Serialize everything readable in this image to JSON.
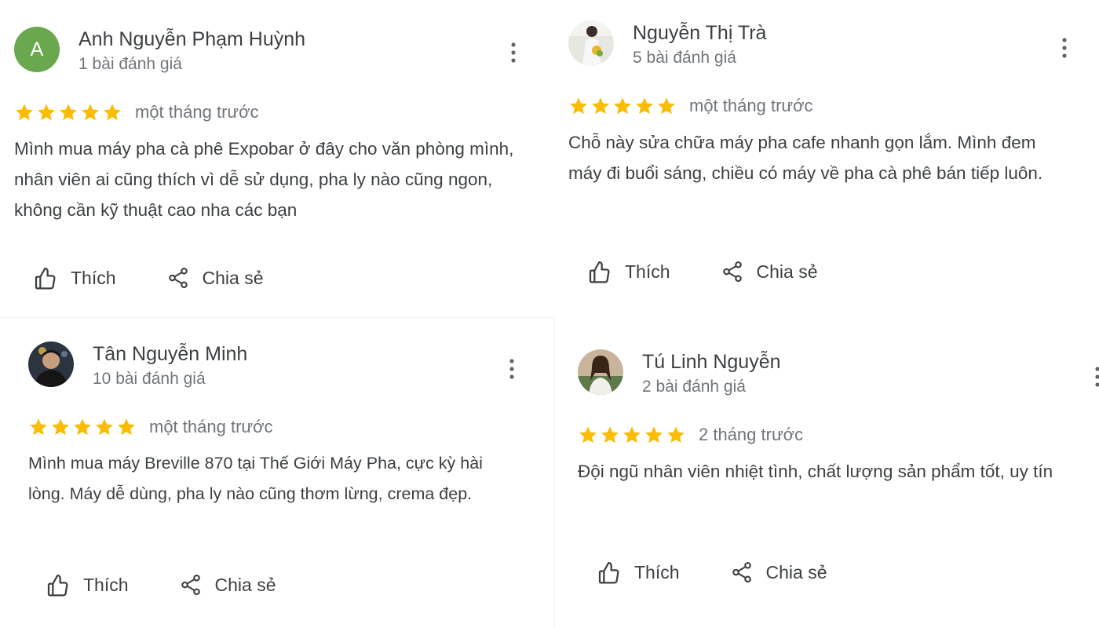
{
  "actions": {
    "like_label": "Thích",
    "share_label": "Chia sẻ"
  },
  "colors": {
    "star": "#fbbc04",
    "avatar_letter_bg": "#6aa84f",
    "text": "#3c4043",
    "muted": "#70757a"
  },
  "icons": {
    "like": "thumb-up-outline-icon",
    "share": "share-icon",
    "more": "more-vert-icon",
    "star": "star-icon"
  },
  "reviews": [
    {
      "avatar_letter": "A",
      "name": "Anh Nguyễn Phạm Huỳnh",
      "review_count": "1 bài đánh giá",
      "rating": 5,
      "time": "một tháng trước",
      "text": "Mình mua máy pha cà phê Expobar ở đây cho văn phòng mình, nhân viên ai cũng thích vì dễ sử dụng, pha ly nào cũng ngon, không cần kỹ thuật cao nha các bạn"
    },
    {
      "avatar_letter": "",
      "name": "Nguyễn Thị Trà",
      "review_count": "5 bài đánh giá",
      "rating": 5,
      "time": "một tháng trước",
      "text": "Chỗ này sửa chữa máy pha cafe nhanh gọn lắm. Mình đem máy đi buổi sáng, chiều có máy về pha cà phê bán tiếp luôn."
    },
    {
      "avatar_letter": "",
      "name": "Tân Nguyễn Minh",
      "review_count": "10 bài đánh giá",
      "rating": 5,
      "time": "một tháng trước",
      "text": "Mình mua máy Breville 870 tại Thế Giới Máy Pha, cực kỳ hài lòng. Máy dễ dùng, pha ly nào cũng thơm lừng, crema đẹp."
    },
    {
      "avatar_letter": "",
      "name": "Tú Linh Nguyễn",
      "review_count": "2 bài đánh giá",
      "rating": 5,
      "time": "2 tháng trước",
      "text": "Đội ngũ nhân viên nhiệt tình, chất lượng sản phẩm tốt, uy tín"
    }
  ]
}
